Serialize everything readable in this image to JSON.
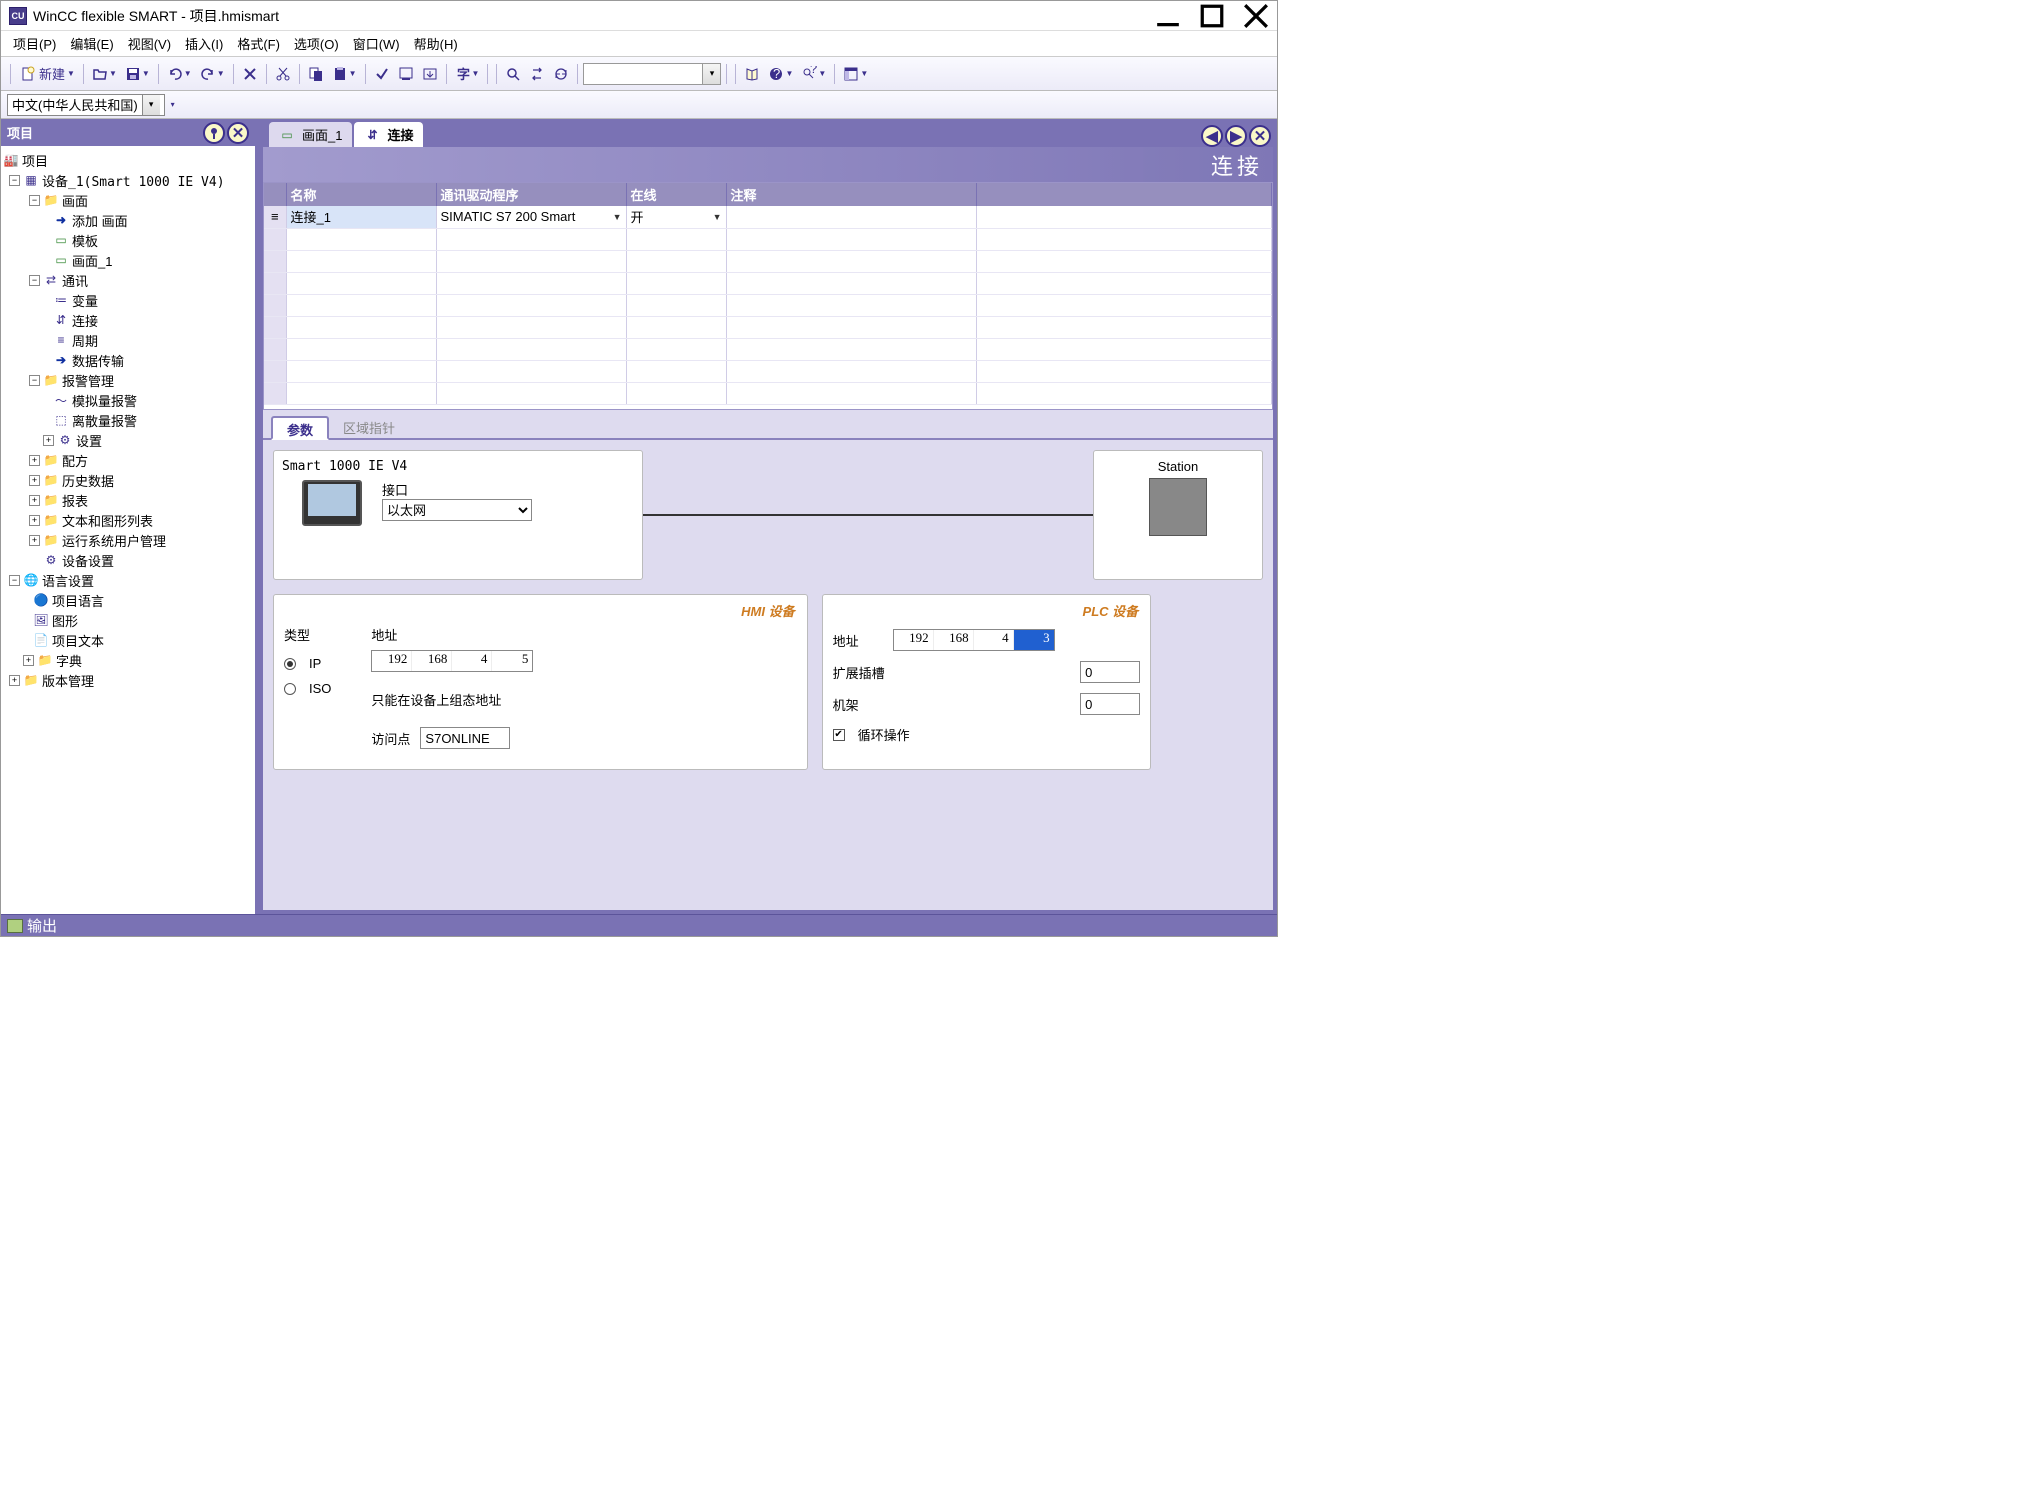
{
  "titlebar": {
    "title": "WinCC flexible SMART - 项目.hmismart",
    "app_icon_text": "CU"
  },
  "menus": {
    "project": "项目(P)",
    "edit": "编辑(E)",
    "view": "视图(V)",
    "insert": "插入(I)",
    "format": "格式(F)",
    "options": "选项(O)",
    "window": "窗口(W)",
    "help": "帮助(H)"
  },
  "toolbar": {
    "new_label": "新建"
  },
  "langbar": {
    "language": "中文(中华人民共和国)"
  },
  "left_panel": {
    "title": "项目"
  },
  "tree": {
    "root": "项目",
    "device": "设备_1(Smart 1000 IE V4)",
    "screen_folder": "画面",
    "add_screen": "添加 画面",
    "template": "模板",
    "screen1": "画面_1",
    "comm": "通讯",
    "vars": "变量",
    "connections": "连接",
    "cycle": "周期",
    "datatrans": "数据传输",
    "alarm": "报警管理",
    "analog_alarm": "模拟量报警",
    "discrete_alarm": "离散量报警",
    "settings": "设置",
    "recipe": "配方",
    "histdata": "历史数据",
    "report": "报表",
    "textgraphics": "文本和图形列表",
    "usermgmt": "运行系统用户管理",
    "devsettings": "设备设置",
    "lang_settings": "语言设置",
    "proj_lang": "项目语言",
    "graphics": "图形",
    "proj_text": "项目文本",
    "dict": "字典",
    "version": "版本管理"
  },
  "tabs": {
    "tab1": "画面_1",
    "tab2": "连接"
  },
  "content_title": "连接",
  "grid": {
    "cols": {
      "name": "名称",
      "driver": "通讯驱动程序",
      "online": "在线",
      "comment": "注释"
    },
    "row1": {
      "name": "连接_1",
      "driver": "SIMATIC S7 200 Smart",
      "online": "开",
      "comment": ""
    }
  },
  "detail_tabs": {
    "params": "参数",
    "areaptr": "区域指针"
  },
  "diagram": {
    "hmi_title": "Smart 1000 IE V4",
    "interface_label": "接口",
    "interface_value": "以太网",
    "station": "Station"
  },
  "hmi_panel": {
    "title": "HMI 设备",
    "type": "类型",
    "ip": "IP",
    "iso": "ISO",
    "addr": "地址",
    "addr_val": [
      "192",
      "168",
      "4",
      "5"
    ],
    "note": "只能在设备上组态地址",
    "accesspoint": "访问点",
    "accesspoint_val": "S7ONLINE"
  },
  "plc_panel": {
    "title": "PLC 设备",
    "addr": "地址",
    "addr_val": [
      "192",
      "168",
      "4",
      "3"
    ],
    "slot": "扩展插槽",
    "slot_val": "0",
    "rack": "机架",
    "rack_val": "0",
    "cyclic": "循环操作"
  },
  "outputbar": {
    "label": "输出"
  }
}
